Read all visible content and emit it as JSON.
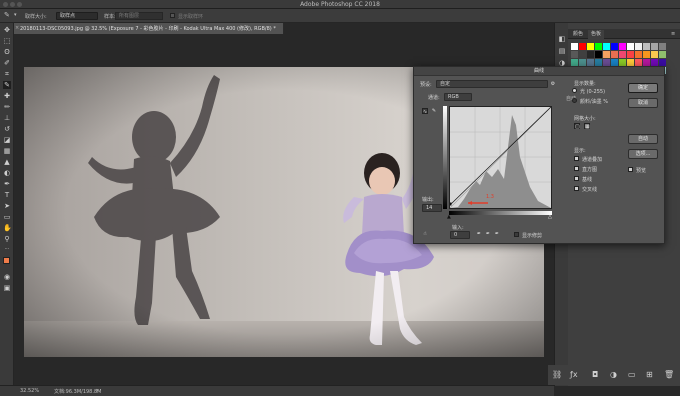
{
  "window": {
    "title": "Adobe Photoshop CC 2018"
  },
  "options_bar": {
    "sample_size_label": "取样大小:",
    "sample_size_value": "取样点",
    "sample_label": "样本:",
    "sample_value": "所有图层",
    "show_ring_label": "显示取样环"
  },
  "document_tab": {
    "title": "20180113-DSC05093.jpg @ 32.5% (Exposure 7 - 彩色胶片 - 印刷 - Kodak Ultra Max 400 (修改), RGB/8) *"
  },
  "status_bar": {
    "zoom": "32.52%",
    "doc_size": "文档:96.3M/198.8M"
  },
  "panels": {
    "tabs": [
      "颜色",
      "色板"
    ],
    "swatch_colors": [
      "#ffffff",
      "#ff0000",
      "#ffff00",
      "#00ff00",
      "#00ffff",
      "#0000ff",
      "#ff00ff",
      "#ffffff",
      "#f2f2f2",
      "#bfbfbf",
      "#a6a6a6",
      "#808080",
      "#595959",
      "#404040",
      "#262626",
      "#000000",
      "#f4a261",
      "#e76f51",
      "#ef476f",
      "#f94144",
      "#f3722c",
      "#f8961e",
      "#f9c74f",
      "#90be6d",
      "#43aa8b",
      "#4d908e",
      "#577590",
      "#277da1",
      "#6a4c93",
      "#1982c4",
      "#8ac926",
      "#ffca3a",
      "#ff595e",
      "#b5179e",
      "#7209b7",
      "#3a0ca3",
      "#4361ee",
      "#4cc9f0",
      "#06d6a0",
      "#118ab2",
      "#073b4c",
      "#ffd166",
      "#fb8500",
      "#219ebc",
      "#8ecae6",
      "#023047",
      "#e63946",
      "#a8dadc",
      "#457b9d",
      "#1d3557"
    ]
  },
  "curves_dialog": {
    "title": "曲线",
    "preset_label": "预设:",
    "preset_value": "自定",
    "channel_label": "通道:",
    "channel_value": "RGB",
    "auto_label": "自动",
    "output_label": "输出:",
    "output_value": "14",
    "input_label": "输入:",
    "input_value": "0",
    "show_clipping_label": "显示修剪",
    "display_amount_label": "显示数量:",
    "light_option": "光 (0-255)",
    "pigment_option": "颜料/油墨 %",
    "grid_size_label": "网格大小:",
    "show_label": "显示:",
    "show_channel_overlay": "通道叠加",
    "show_histogram": "直方图",
    "show_baseline": "基线",
    "show_intersection": "交叉线",
    "ok_button": "确定",
    "cancel_button": "取消",
    "options_button": "选项...",
    "preview_label": "预览",
    "curve_point_annotation": "1.3"
  }
}
